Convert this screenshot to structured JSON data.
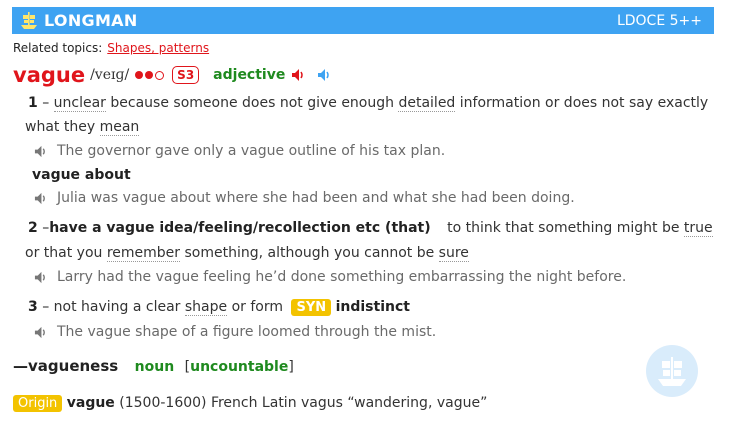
{
  "header": {
    "brand": "LONGMAN",
    "edition": "LDOCE 5++"
  },
  "related": {
    "label": "Related topics:",
    "link": "Shapes, patterns"
  },
  "entry": {
    "headword": "vague",
    "pronunciation": "/veɪɡ/",
    "frequency": "S3",
    "pos": "adjective"
  },
  "senses": {
    "s1": {
      "num": "1",
      "dash": "–",
      "w_unclear": "unclear",
      "t_a": " because someone does not give enough ",
      "w_detailed": "detailed",
      "t_b": " information or does not say exactly",
      "t_c": "what they ",
      "w_mean": "mean",
      "ex1": "The governor gave only a vague outline of his tax plan.",
      "phrase": "vague about",
      "ex2": "Julia was vague about where she had been and what she had been doing."
    },
    "s2": {
      "num": "2",
      "dash": "–",
      "phrase": "have a vague idea/feeling/recollection etc (that)",
      "t_a": "to think that something might be ",
      "w_true": "true",
      "t_b": "or that you ",
      "w_remember": "remember",
      "t_c": " something, although you cannot be ",
      "w_sure": "sure",
      "ex": "Larry had the vague feeling he’d done something embarrassing the night before."
    },
    "s3": {
      "num": "3",
      "dash": "–",
      "t_a": "not having a clear ",
      "w_shape": "shape",
      "t_b": " or form",
      "syn_label": "SYN",
      "syn_word": "indistinct",
      "ex": "The vague shape of a figure loomed through the mist."
    }
  },
  "derived": {
    "word": "—vagueness",
    "pos": "noun",
    "bl": "[",
    "gram": "uncountable",
    "br": "]"
  },
  "origin": {
    "label": "Origin",
    "word": "vague",
    "text": " (1500-1600) French Latin vagus “wandering, vague”"
  },
  "colors": {
    "header_bg": "#3ea3f2",
    "headword": "#e0151b",
    "pos": "#1f8a1f",
    "syn_bg": "#f3c300"
  }
}
